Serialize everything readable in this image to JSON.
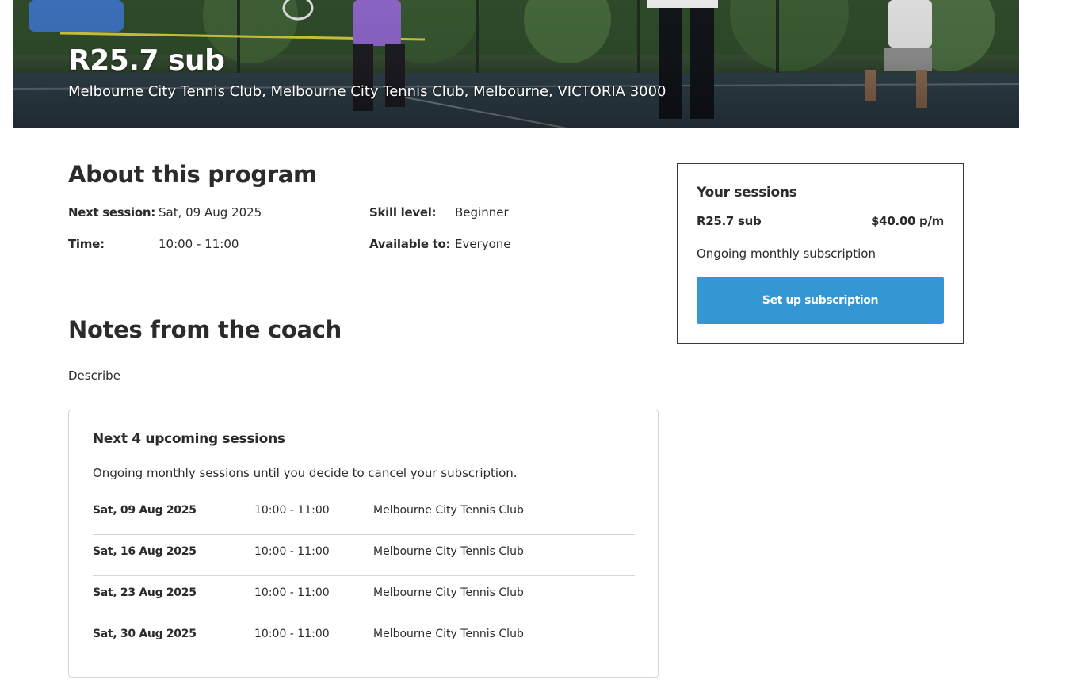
{
  "hero": {
    "title": "R25.7 sub",
    "address": "Melbourne City Tennis Club, Melbourne City Tennis Club, Melbourne, VICTORIA 3000"
  },
  "about": {
    "heading": "About this program",
    "next_session_label": "Next session:",
    "next_session_value": "Sat, 09 Aug 2025",
    "time_label": "Time:",
    "time_value": "10:00 - 11:00",
    "skill_label": "Skill level:",
    "skill_value": "Beginner",
    "available_label": "Available to:",
    "available_value": "Everyone"
  },
  "notes": {
    "heading": "Notes from the coach",
    "text": "Describe"
  },
  "upcoming": {
    "heading": "Next 4 upcoming sessions",
    "description": "Ongoing monthly sessions until you decide to cancel your subscription.",
    "sessions": [
      {
        "date": "Sat, 09 Aug 2025",
        "time": "10:00 - 11:00",
        "location": "Melbourne City Tennis Club"
      },
      {
        "date": "Sat, 16 Aug 2025",
        "time": "10:00 - 11:00",
        "location": "Melbourne City Tennis Club"
      },
      {
        "date": "Sat, 23 Aug 2025",
        "time": "10:00 - 11:00",
        "location": "Melbourne City Tennis Club"
      },
      {
        "date": "Sat, 30 Aug 2025",
        "time": "10:00 - 11:00",
        "location": "Melbourne City Tennis Club"
      }
    ]
  },
  "panel": {
    "heading": "Your sessions",
    "program_name": "R25.7 sub",
    "price": "$40.00 p/m",
    "description": "Ongoing monthly subscription",
    "button_label": "Set up subscription"
  },
  "colors": {
    "accent": "#3497d3",
    "text": "#2b2b2b",
    "divider": "#d6d6d6"
  }
}
